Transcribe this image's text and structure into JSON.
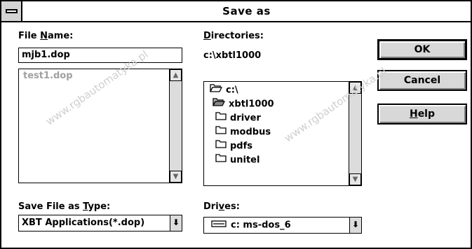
{
  "window": {
    "title": "Save as"
  },
  "file_name": {
    "label_pre": "File ",
    "label_ul": "N",
    "label_post": "ame:",
    "value": "mjb1.dop",
    "files": [
      "test1.dop"
    ]
  },
  "directories": {
    "label_ul": "D",
    "label_post": "irectories:",
    "current_path": "c:\\xbtl1000",
    "items": [
      {
        "label": "c:\\",
        "icon": "open-folder-icon"
      },
      {
        "label": "xbtl1000",
        "icon": "open-folder-icon"
      },
      {
        "label": "driver",
        "icon": "folder-icon"
      },
      {
        "label": "modbus",
        "icon": "folder-icon"
      },
      {
        "label": "pdfs",
        "icon": "folder-icon"
      },
      {
        "label": "unitel",
        "icon": "folder-icon"
      }
    ]
  },
  "save_type": {
    "label_pre": "Save File as ",
    "label_ul": "T",
    "label_post": "ype:",
    "value": "XBT Applications(*.dop)"
  },
  "drives": {
    "label_pre": "Dri",
    "label_ul": "v",
    "label_post": "es:",
    "value": "c: ms-dos_6"
  },
  "buttons": {
    "ok": "OK",
    "cancel": "Cancel",
    "help_ul": "H",
    "help_post": "elp"
  },
  "watermarks": [
    "www.rgbautomatyka.pl"
  ],
  "colors": {
    "background": "#ffffff",
    "button_face": "#d8d8d8",
    "disabled_text": "#a0a0a0"
  }
}
